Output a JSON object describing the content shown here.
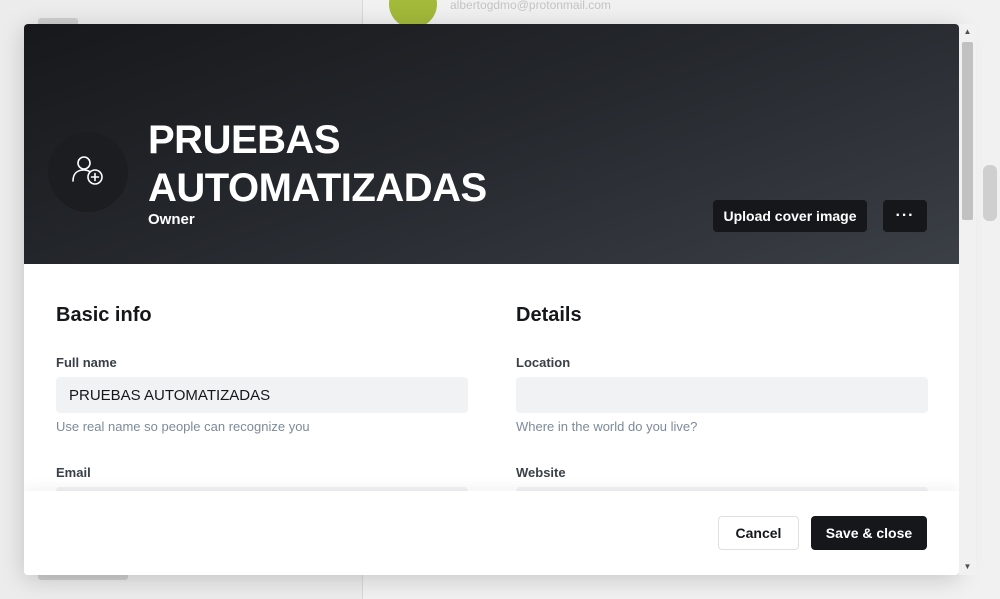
{
  "background": {
    "email": "albertogdmo@protonmail.com"
  },
  "profile": {
    "avatar_icon": "user-add-icon",
    "name": "PRUEBAS AUTOMATIZADAS",
    "role": "Owner",
    "upload_label": "Upload cover image",
    "more_label": "···"
  },
  "basic_info": {
    "title": "Basic info",
    "full_name": {
      "label": "Full name",
      "value": "PRUEBAS AUTOMATIZADAS",
      "hint": "Use real name so people can recognize you"
    },
    "email": {
      "label": "Email",
      "value": ""
    }
  },
  "details": {
    "title": "Details",
    "location": {
      "label": "Location",
      "value": "",
      "hint": "Where in the world do you live?"
    },
    "website": {
      "label": "Website",
      "value": ""
    }
  },
  "footer": {
    "cancel_label": "Cancel",
    "save_label": "Save & close"
  },
  "colors": {
    "cover_dark": "#17181b",
    "button_dark": "#15171a",
    "input_bg": "#f1f2f4",
    "hint": "#7c8b9a"
  }
}
